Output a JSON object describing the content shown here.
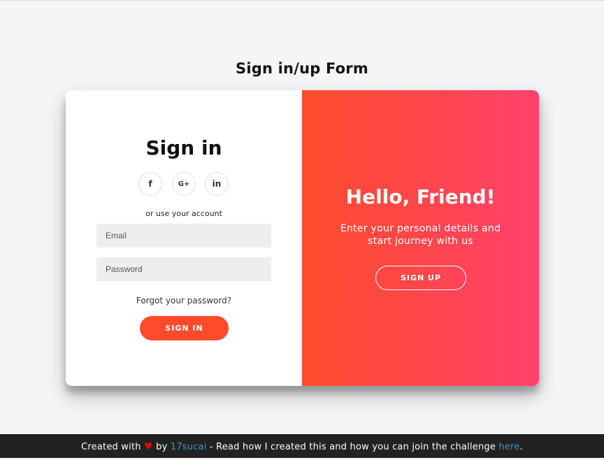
{
  "page": {
    "title": "Sign in/up Form"
  },
  "signin": {
    "title": "Sign in",
    "social": [
      {
        "icon": "facebook-icon",
        "glyph": "f"
      },
      {
        "icon": "google-plus-icon",
        "glyph": "G+"
      },
      {
        "icon": "linkedin-icon",
        "glyph": "in"
      }
    ],
    "alt_text": "or use your account",
    "email_placeholder": "Email",
    "password_placeholder": "Password",
    "forgot": "Forgot your password?",
    "button": "SIGN IN"
  },
  "overlay": {
    "title": "Hello, Friend!",
    "text": "Enter your personal details and start journey with us",
    "button": "SIGN UP"
  },
  "footer": {
    "prefix": "Created with",
    "heart": "♥",
    "by": "by",
    "author": "17sucai",
    "middle": "- Read how I created this and how you can join the challenge",
    "link": "here",
    "suffix": "."
  },
  "colors": {
    "accent": "#ff4b2b",
    "gradient_end": "#ff416c",
    "footer_bg": "#222222",
    "link": "#3c97bf"
  }
}
